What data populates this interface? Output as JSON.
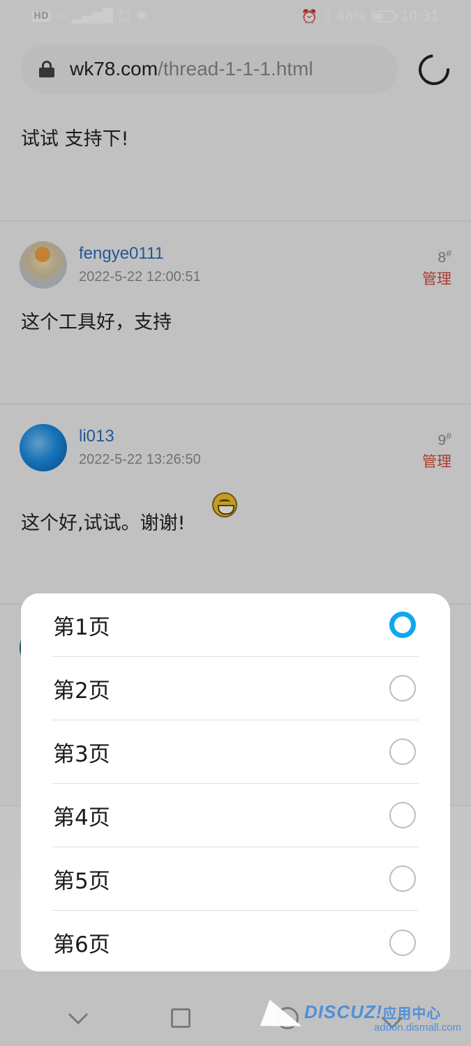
{
  "status_bar": {
    "left_badge": "HD",
    "network": "4G",
    "speed_value": "3.4",
    "speed_unit": "K/s",
    "battery": "48%",
    "time": "10:31"
  },
  "browser": {
    "url_domain": "wk78.com",
    "url_path": "/thread-1-1-1.html"
  },
  "posts": [
    {
      "text": "试试 支持下!"
    },
    {
      "username": "fengye0111",
      "time": "2022-5-22 12:00:51",
      "floor": "8",
      "floor_mark": "#",
      "manage": "管理",
      "text": "这个工具好，支持"
    },
    {
      "username": "li013",
      "time": "2022-5-22 13:26:50",
      "floor": "9",
      "floor_mark": "#",
      "manage": "管理",
      "text": "这个好,试试。谢谢!"
    }
  ],
  "page_picker": {
    "options": [
      {
        "label": "第1页",
        "selected": true
      },
      {
        "label": "第2页",
        "selected": false
      },
      {
        "label": "第3页",
        "selected": false
      },
      {
        "label": "第4页",
        "selected": false
      },
      {
        "label": "第5页",
        "selected": false
      },
      {
        "label": "第6页",
        "selected": false
      }
    ],
    "accent_color": "#10a6f0"
  },
  "watermark": {
    "brand": "DISCUZ!",
    "brand_cn": "应用中心",
    "site": "addon.dismall.com"
  },
  "colors": {
    "username": "#2e6dbd",
    "manage": "#d84a3a"
  }
}
